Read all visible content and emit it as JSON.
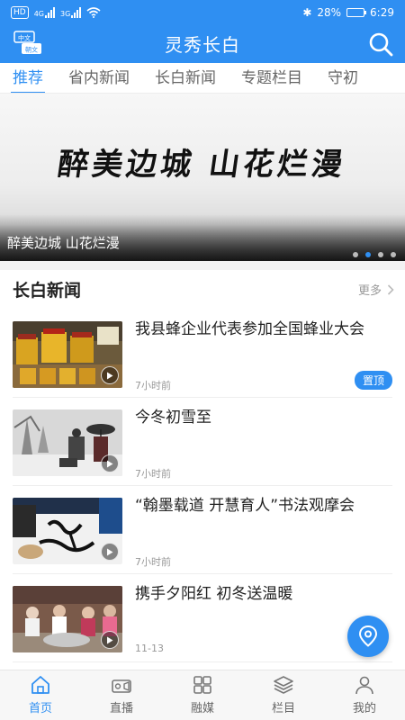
{
  "status_bar": {
    "hd_label": "HD",
    "network_1": "4G",
    "network_2": "3G",
    "bluetooth": "✱",
    "battery_percent": "28%",
    "battery_level": 0.28,
    "time": "6:29"
  },
  "app": {
    "title": "灵秀长白",
    "lang_icon_top": "中文",
    "lang_icon_bottom": "朝文"
  },
  "tabs": [
    {
      "label": "推荐",
      "active": true
    },
    {
      "label": "省内新闻",
      "active": false
    },
    {
      "label": "长白新闻",
      "active": false
    },
    {
      "label": "专题栏目",
      "active": false
    },
    {
      "label": "守初",
      "active": false
    }
  ],
  "banner": {
    "art_text": "醉美边城 山花烂漫",
    "caption": "醉美边城 山花烂漫",
    "dot_count": 4,
    "active_dot": 1
  },
  "section": {
    "title": "长白新闻",
    "more_label": "更多"
  },
  "news": [
    {
      "title": "我县蜂企业代表参加全国蜂业大会",
      "time": "7小时前",
      "badge": "置顶",
      "thumb": "honey"
    },
    {
      "title": "今冬初雪至",
      "time": "7小时前",
      "badge": "",
      "thumb": "snow"
    },
    {
      "title": "“翰墨载道 开慧育人”书法观摩会",
      "time": "7小时前",
      "badge": "",
      "thumb": "calligraphy"
    },
    {
      "title": "携手夕阳红 初冬送温暖",
      "time": "11-13",
      "badge": "",
      "thumb": "kitchen"
    }
  ],
  "bottom_nav": [
    {
      "label": "首页",
      "icon": "home-icon",
      "active": true
    },
    {
      "label": "直播",
      "icon": "camera-icon",
      "active": false
    },
    {
      "label": "融媒",
      "icon": "grid-icon",
      "active": false
    },
    {
      "label": "栏目",
      "icon": "layers-icon",
      "active": false
    },
    {
      "label": "我的",
      "icon": "user-icon",
      "active": false
    }
  ],
  "colors": {
    "primary": "#2f8ff2",
    "text": "#222222",
    "muted": "#999999"
  }
}
